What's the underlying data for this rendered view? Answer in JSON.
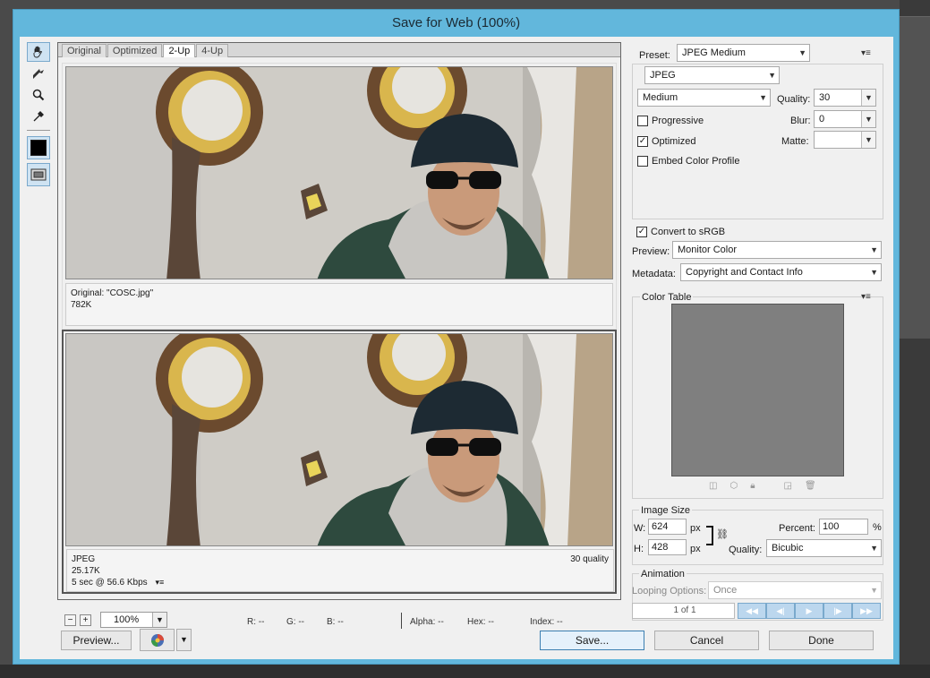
{
  "window": {
    "title": "Save for Web (100%)"
  },
  "tabs": [
    {
      "label": "Original"
    },
    {
      "label": "Optimized"
    },
    {
      "label": "2-Up"
    },
    {
      "label": "4-Up"
    }
  ],
  "panes": {
    "original": {
      "line1": "Original: \"COSC.jpg\"",
      "line2": "782K"
    },
    "optimized": {
      "line1": "JPEG",
      "line2": "25.17K",
      "line3": "5 sec @ 56.6 Kbps",
      "quality_note": "30 quality"
    }
  },
  "status": {
    "zoom": "100%",
    "r": "R: --",
    "g": "G: --",
    "b": "B: --",
    "alpha": "Alpha: --",
    "hex": "Hex: --",
    "index": "Index: --"
  },
  "buttons": {
    "preview": "Preview...",
    "save": "Save...",
    "cancel": "Cancel",
    "done": "Done"
  },
  "settings": {
    "preset_label": "Preset:",
    "preset_value": "JPEG Medium",
    "format": "JPEG",
    "quality_preset": "Medium",
    "quality_label": "Quality:",
    "quality_value": "30",
    "progressive_label": "Progressive",
    "progressive_checked": false,
    "blur_label": "Blur:",
    "blur_value": "0",
    "optimized_label": "Optimized",
    "optimized_checked": true,
    "matte_label": "Matte:",
    "matte_value": "",
    "embed_label": "Embed Color Profile",
    "embed_checked": false,
    "srgb_label": "Convert to sRGB",
    "srgb_checked": true,
    "preview_label": "Preview:",
    "preview_value": "Monitor Color",
    "metadata_label": "Metadata:",
    "metadata_value": "Copyright and Contact Info"
  },
  "color_table": {
    "title": "Color Table",
    "fill": "#7f7f7f"
  },
  "image_size": {
    "title": "Image Size",
    "w_label": "W:",
    "w_value": "624",
    "w_unit": "px",
    "h_label": "H:",
    "h_value": "428",
    "h_unit": "px",
    "percent_label": "Percent:",
    "percent_value": "100",
    "percent_unit": "%",
    "quality_label": "Quality:",
    "quality_value": "Bicubic"
  },
  "animation": {
    "title": "Animation",
    "looping_label": "Looping Options:",
    "looping_value": "Once",
    "frame_counter": "1 of 1"
  },
  "colors": {
    "title_bar": "#62b7dc",
    "dialog_bg": "#f0f0f0"
  }
}
